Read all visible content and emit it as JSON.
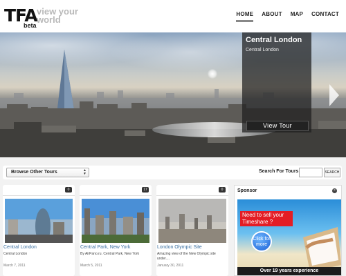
{
  "header": {
    "logo_text": "TFA",
    "logo_badge": "beta",
    "tagline_line1": "view your",
    "tagline_line2": "world",
    "nav": [
      {
        "label": "HOME",
        "active": true
      },
      {
        "label": "ABOUT",
        "active": false
      },
      {
        "label": "MAP",
        "active": false
      },
      {
        "label": "CONTACT",
        "active": false
      }
    ]
  },
  "hero": {
    "title": "Central London",
    "subtitle": "Central London",
    "view_button": "View  Tour",
    "next_icon": "chevron-right-icon"
  },
  "browse": {
    "select_label": "Browse Other Tours",
    "search_label": "Search For Tours",
    "search_button": "SEARCH",
    "search_placeholder": ""
  },
  "tours": [
    {
      "title": "Central London",
      "description": "Central London",
      "date": "March 7, 2011",
      "comments": "0"
    },
    {
      "title": "Central Park, New York",
      "description": "By AirPano.ru. Central Park, New York",
      "date": "March 5, 2011",
      "comments": "17"
    },
    {
      "title": "London Olympic Site",
      "description": "Amazing view of the New Olympic site under....",
      "date": "January 30, 2011",
      "comments": "0"
    }
  ],
  "sponsor": {
    "label": "Sponsor",
    "ad_headline": "Need to sell your Timeshare ?",
    "ad_button": "Click for more",
    "ad_footer": "Over 19 years experience"
  },
  "colors": {
    "link": "#3a6fa0",
    "ad_red": "#e31d25",
    "nav_underline": "#888888"
  }
}
